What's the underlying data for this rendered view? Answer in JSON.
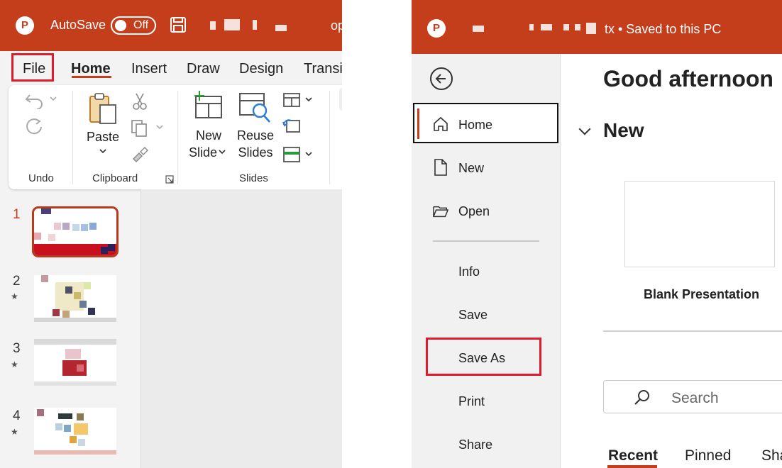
{
  "left_window": {
    "autosave_label": "AutoSave",
    "autosave_state": "Off",
    "title_tail": "op",
    "tabs": [
      {
        "label": "File"
      },
      {
        "label": "Home",
        "active": true
      },
      {
        "label": "Insert"
      },
      {
        "label": "Draw"
      },
      {
        "label": "Design"
      },
      {
        "label": "Transit"
      }
    ],
    "ribbon": {
      "groups": {
        "undo": "Undo",
        "clipboard": "Clipboard",
        "slides": "Slides"
      },
      "paste_label": "Paste",
      "new_slide_label_1": "New",
      "new_slide_label_2": "Slide",
      "reuse_slides_label_1": "Reuse",
      "reuse_slides_label_2": "Slides"
    },
    "slides": [
      {
        "num": "1",
        "star": ""
      },
      {
        "num": "2",
        "star": "★"
      },
      {
        "num": "3",
        "star": "★"
      },
      {
        "num": "4",
        "star": "★"
      }
    ]
  },
  "right_window": {
    "title_status": "tx • Saved to this PC",
    "nav": {
      "home": "Home",
      "new": "New",
      "open": "Open",
      "info": "Info",
      "save": "Save",
      "save_as": "Save As",
      "print": "Print",
      "share": "Share"
    },
    "greeting": "Good afternoon",
    "new_section": "New",
    "blank_presentation": "Blank Presentation",
    "search_placeholder": "Search",
    "tabs": [
      {
        "label": "Recent",
        "active": true
      },
      {
        "label": "Pinned"
      },
      {
        "label": "Sha"
      }
    ]
  },
  "colors": {
    "brand": "#c43e1c",
    "highlight": "#e01b2d"
  }
}
